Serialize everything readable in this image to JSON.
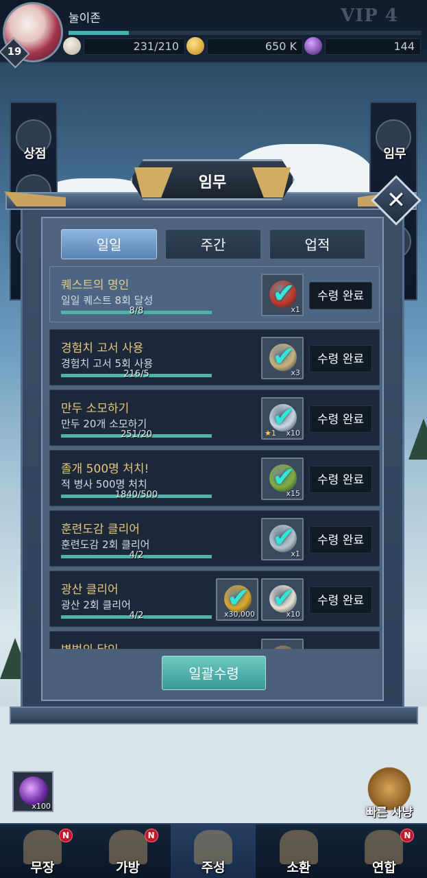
{
  "player": {
    "name": "눌이존",
    "level": "19",
    "vip": "VIP 4",
    "exp_fraction": 0.17,
    "stamina": "231/210",
    "gold": "650 K",
    "gems": "144"
  },
  "side_menu": {
    "shop": "상점",
    "mission": "임무",
    "bonus_left": "0"
  },
  "dialog": {
    "title": "임무",
    "tabs": [
      {
        "label": "일일",
        "active": true
      },
      {
        "label": "주간",
        "active": false
      },
      {
        "label": "업적",
        "active": false
      }
    ],
    "quests": [
      {
        "title": "퀘스트의 명인",
        "desc": "일일 퀘스트 8회 달성",
        "progress": "8/8",
        "fill": 1.0,
        "rewards": [
          {
            "icon": "gift-bundle-icon",
            "qty": "x1",
            "color": "#c0392b"
          }
        ],
        "button": "수령 완료"
      },
      {
        "title": "경험치 고서 사용",
        "desc": "경험치 고서 5회 사용",
        "progress": "216/5",
        "fill": 1.0,
        "rewards": [
          {
            "icon": "exp-book-icon",
            "qty": "x3",
            "color": "#c9b27a"
          }
        ],
        "button": "수령 완료"
      },
      {
        "title": "만두 소모하기",
        "desc": "만두 20개 소모하기",
        "progress": "251/20",
        "fill": 1.0,
        "rewards": [
          {
            "icon": "hero-shard-icon",
            "qty": "x10",
            "star": "★1",
            "color": "#c9d6e3"
          }
        ],
        "button": "수령 완료"
      },
      {
        "title": "졸개 500명 처치!",
        "desc": "적 병사 500명 처치",
        "progress": "1840/500",
        "fill": 1.0,
        "rewards": [
          {
            "icon": "jade-token-icon",
            "qty": "x15",
            "color": "#7fae3c"
          }
        ],
        "button": "수령 완료"
      },
      {
        "title": "훈련도감 클리어",
        "desc": "훈련도감 2회 클리어",
        "progress": "4/2",
        "fill": 1.0,
        "rewards": [
          {
            "icon": "sword-icon",
            "qty": "x1",
            "color": "#b8c4cf"
          }
        ],
        "button": "수령 완료"
      },
      {
        "title": "광산 클리어",
        "desc": "광산 2회 클리어",
        "progress": "4/2",
        "fill": 1.0,
        "rewards": [
          {
            "icon": "gold-coin-icon",
            "qty": "x30,000",
            "color": "#d9a62b"
          },
          {
            "icon": "dumpling-icon",
            "qty": "x10",
            "color": "#e7e0d3"
          }
        ],
        "button": "수령 완료"
      },
      {
        "title": "병법의 달인",
        "desc": "",
        "progress": "",
        "fill": 1.0,
        "rewards": [
          {
            "icon": "scroll-icon",
            "qty": "",
            "color": "#8a6b4a"
          }
        ],
        "button": ""
      }
    ],
    "claim_all": "일괄수령"
  },
  "scene": {
    "orb_qty": "x100",
    "quick_hunt": "빠른 사냥"
  },
  "nav": [
    {
      "label": "무장",
      "badge": "N",
      "icon": "general-icon"
    },
    {
      "label": "가방",
      "badge": "N",
      "icon": "bag-icon"
    },
    {
      "label": "주성",
      "badge": "",
      "icon": "castle-icon"
    },
    {
      "label": "소환",
      "badge": "",
      "icon": "summon-icon"
    },
    {
      "label": "연합",
      "badge": "N",
      "icon": "alliance-flag-icon"
    }
  ],
  "colors": {
    "accent_teal": "#35e6d8",
    "quest_title_gold": "#e5c77f",
    "badge_red": "#c0182a"
  }
}
